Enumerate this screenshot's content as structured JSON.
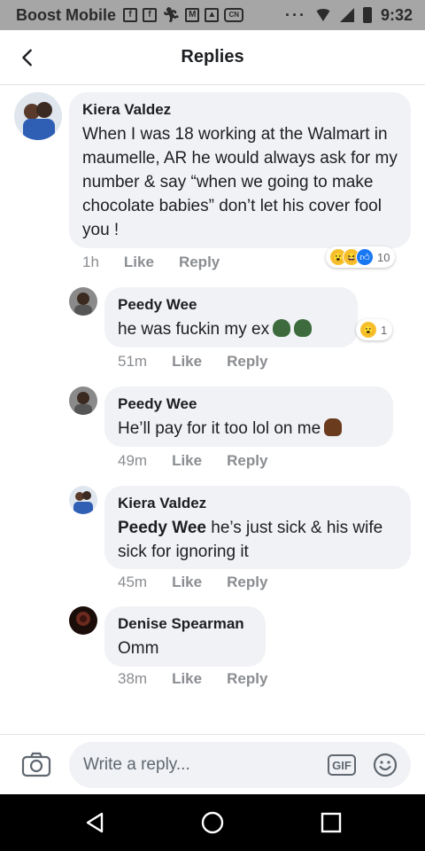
{
  "status_bar": {
    "carrier": "Boost Mobile",
    "notification_icons": [
      "f-icon",
      "f-icon",
      "run-icon",
      "mail-icon",
      "image-icon",
      "news-icon"
    ],
    "more": "···",
    "time": "9:32"
  },
  "header": {
    "title": "Replies"
  },
  "comments": [
    {
      "author": "Kiera Valdez",
      "text": "When I was 18 working at the Walmart in maumelle, AR he would always ask for my number & say “when we going to make chocolate babies” don’t let his cover fool you !",
      "time": "1h",
      "like": "Like",
      "reply": "Reply",
      "reactions": [
        "wow",
        "haha",
        "like"
      ],
      "reaction_count": "10"
    },
    {
      "author": "Peedy Wee",
      "text": "he was fuckin my ex",
      "time": "51m",
      "like": "Like",
      "reply": "Reply",
      "reactions": [
        "wow"
      ],
      "reaction_count": "1"
    },
    {
      "author": "Peedy Wee",
      "text": "He’ll pay for it too lol on me",
      "time": "49m",
      "like": "Like",
      "reply": "Reply"
    },
    {
      "author": "Kiera Valdez",
      "mention": "Peedy Wee",
      "text": " he’s just sick & his wife sick for ignoring it",
      "time": "45m",
      "like": "Like",
      "reply": "Reply"
    },
    {
      "author": "Denise Spearman",
      "text": "Omm",
      "time": "38m",
      "like": "Like",
      "reply": "Reply"
    }
  ],
  "composer": {
    "placeholder": "Write a reply...",
    "gif_label": "GIF"
  },
  "colors": {
    "bubble": "#f0f2f5",
    "meta": "#8a8d91",
    "like_blue": "#1877f2",
    "status_bar": "#a6a6a6"
  }
}
